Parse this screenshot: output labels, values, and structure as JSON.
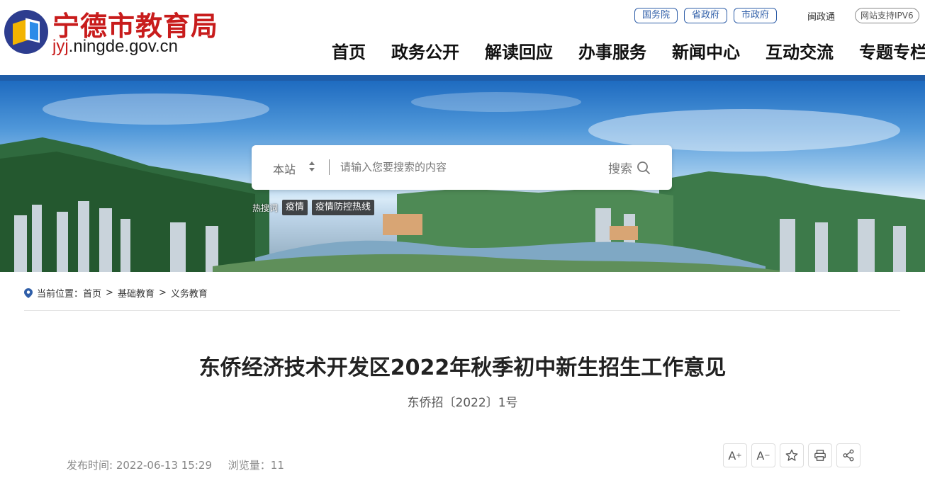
{
  "header": {
    "site_title": "宁德市教育局",
    "domain_prefix": "jyj",
    "domain_suffix": ".ningde.gov.cn",
    "gov_links": [
      "国务院",
      "省政府",
      "市政府"
    ],
    "minzheng": "闽政通",
    "ipv6": "网站支持IPV6",
    "nav": [
      "首页",
      "政务公开",
      "解读回应",
      "办事服务",
      "新闻中心",
      "互动交流",
      "专题专栏"
    ]
  },
  "search": {
    "scope": "本站",
    "placeholder": "请输入您要搜索的内容",
    "button_label": "搜索",
    "hot_label": "热搜词",
    "hot_words": [
      "疫情",
      "疫情防控热线"
    ]
  },
  "breadcrumb": {
    "prefix": "当前位置：",
    "items": [
      "首页",
      "基础教育",
      "义务教育"
    ]
  },
  "article": {
    "title": "东侨经济技术开发区2022年秋季初中新生招生工作意见",
    "doc_no": "东侨招〔2022〕1号",
    "publish_label": "发布时间: 2022-06-13 15:29",
    "views_label": "浏览量：11"
  },
  "tools": {
    "font_larger": "A",
    "font_smaller": "A"
  },
  "colors": {
    "brand_red": "#c81c1c",
    "brand_blue": "#1f5da8"
  }
}
